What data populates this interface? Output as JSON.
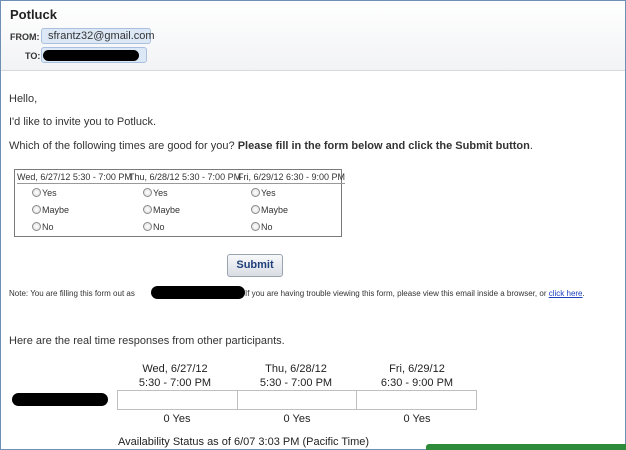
{
  "email": {
    "subject": "Potluck",
    "from_label": "FROM:",
    "from_address": "sfrantz32@gmail.com",
    "to_label": "TO:",
    "to_address": ""
  },
  "body": {
    "greeting": "Hello,",
    "invite": "I'd like to invite you to Potluck.",
    "question": "Which of the following times are good for you?",
    "question_bold": "Please fill in the form below and click the Submit button",
    "question_end": "."
  },
  "poll": {
    "columns": [
      {
        "header": "Wed, 6/27/12 5:30 - 7:00 PM"
      },
      {
        "header": "Thu, 6/28/12 5:30 - 7:00 PM"
      },
      {
        "header": "Fri, 6/29/12 6:30 - 9:00 PM"
      }
    ],
    "options": [
      "Yes",
      "Maybe",
      "No"
    ],
    "submit_label": "Submit"
  },
  "note": {
    "prefix": "Note: You are filling this form out as",
    "middle": "If you are having trouble viewing this form, please view this email inside a browser, or",
    "link": "click here",
    "end": "."
  },
  "results": {
    "intro": "Here are the real time responses from other participants.",
    "columns": [
      {
        "day": "Wed, 6/27/12",
        "time": "5:30 - 7:00 PM",
        "count": "0 Yes"
      },
      {
        "day": "Thu, 6/28/12",
        "time": "5:30 - 7:00 PM",
        "count": "0 Yes"
      },
      {
        "day": "Fri, 6/29/12",
        "time": "6:30 - 9:00 PM",
        "count": "0 Yes"
      }
    ],
    "status": "Availability Status as of 6/07 3:03 PM  (Pacific Time)"
  },
  "colors": {
    "link": "#1a3fbf",
    "frame_border": "#6f8fb5",
    "submit_text": "#1f3f7a",
    "status_bar": "#2e8b3a"
  }
}
